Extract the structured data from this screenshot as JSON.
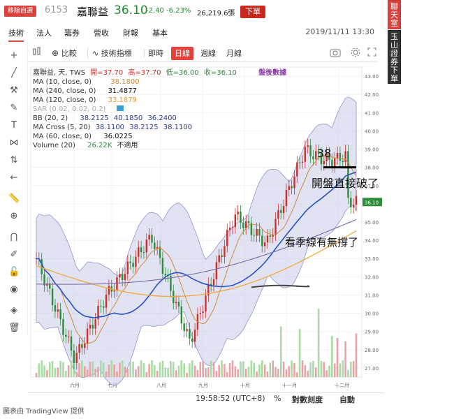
{
  "header": {
    "remove_label": "移除自選",
    "code": "6153",
    "name": "嘉聯益",
    "price": "36.10",
    "change": "-2.40 -6.23%",
    "volume": "26,219.6張",
    "order_label": "下單"
  },
  "subnav": {
    "tabs": [
      "技術",
      "法人",
      "籌券",
      "營收",
      "財報",
      "基本"
    ],
    "datetime": "2019/11/11 13:30"
  },
  "right_bar": {
    "chat_label": "聊天室",
    "bank_label": "玉山證券下單"
  },
  "toolbar": {
    "compare_label": "比較",
    "indicators_label": "技術指標",
    "intraday_label": "即時",
    "day_label": "日線",
    "week_label": "週線",
    "month_label": "月線"
  },
  "legend": {
    "symbol": "嘉聯益, 天, TWS",
    "open": "開=37.70",
    "high": "高=37.70",
    "low": "低=36.00",
    "close": "收=36.10",
    "after_hours": "盤後數據",
    "ma10_label": "MA (10, close, 0)",
    "ma10_value": "38.1800",
    "ma240_label": "MA (240, close, 0)",
    "ma240_value": "31.4877",
    "ma120_label": "MA (120, close, 0)",
    "ma120_value": "33.1879",
    "sar_label": "SAR (0.02, 0.02, 0.2)",
    "bb_label": "BB (20, 2)",
    "bb_values": [
      "38.2125",
      "40.1850",
      "36.2400"
    ],
    "macross_label": "MA Cross (5, 20)",
    "macross_values": [
      "38.1100",
      "38.2125",
      "38.1100"
    ],
    "ma60_label": "MA (60, close, 0)",
    "ma60_value": "36.0225",
    "volume_label": "Volume (20)",
    "volume_value": "26.22K",
    "volume_na": "不適用"
  },
  "chart_data": {
    "type": "candlestick",
    "price_ticks": [
      "43.00",
      "42.00",
      "41.00",
      "40.00",
      "39.00",
      "38.00",
      "37.00",
      "36.00",
      "35.00",
      "34.00",
      "33.00",
      "32.00",
      "31.00",
      "30.00",
      "29.00",
      "28.00",
      "27.00"
    ],
    "price_tick_values": [
      43,
      42,
      41,
      40,
      39,
      38,
      37,
      36,
      35,
      34,
      33,
      32,
      31,
      30,
      29,
      28,
      27
    ],
    "current_price_label": "36.10",
    "current_price": 36.1,
    "x_ticks": [
      "六月",
      "七月",
      "八月",
      "九月",
      "十月",
      "十一月",
      "十二月"
    ],
    "ylim": [
      26.5,
      43.5
    ],
    "grid": true
  },
  "annotations": {
    "level_label": "38",
    "break_note": "開盤直接破了",
    "quarter_note": "看季線有無撐了"
  },
  "status_bar": {
    "time": "19:58:52 (UTC+8)",
    "percent": "%",
    "log_scale": "對數刻度",
    "auto": "自動"
  },
  "footer": {
    "text": "圖表由 TradingView 提供"
  },
  "colors": {
    "up": "#c9302c",
    "down": "#2e8b3a",
    "bb_fill": "#c8cbe8",
    "ma10": "#d18a3a",
    "ma120": "#f2a93b",
    "ma240": "#7b6aa8",
    "ma60": "#2552c8"
  }
}
